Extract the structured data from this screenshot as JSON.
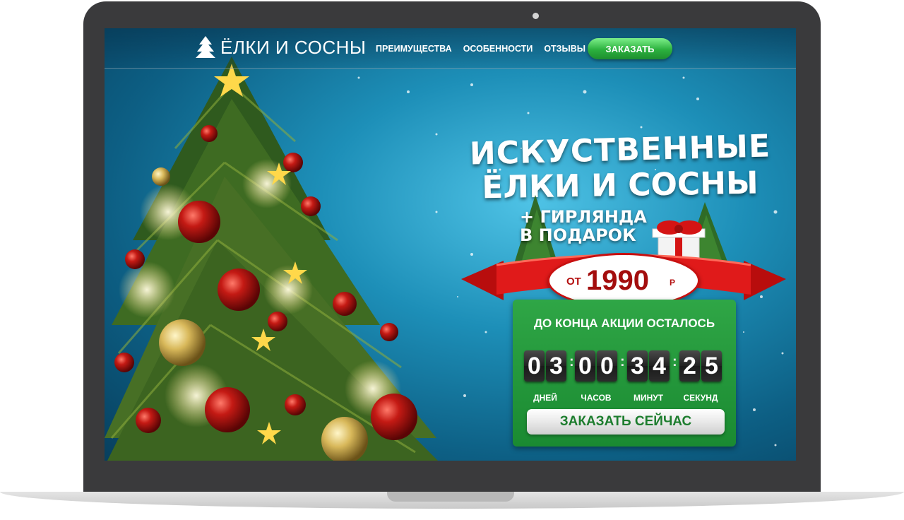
{
  "brand": {
    "name": "ЁЛКИ И СОСНЫ"
  },
  "nav": {
    "links": [
      "ПРЕИМУЩЕСТВА",
      "ОСОБЕННОСТИ",
      "ОТЗЫВЫ"
    ],
    "order_label": "ЗАКАЗАТЬ"
  },
  "hero": {
    "title_line1": "ИСКУСТВЕННЫЕ",
    "title_line2": "ЁЛКИ И СОСНЫ",
    "gift_line1": "+ ГИРЛЯНДА",
    "gift_line2": "В ПОДАРОК"
  },
  "price": {
    "prefix": "ОТ",
    "value": "1990",
    "currency": "Р"
  },
  "promo": {
    "title": "ДО КОНЦА АКЦИИ ОСТАЛОСЬ",
    "digits": [
      "0",
      "3",
      "0",
      "0",
      "3",
      "4",
      "2",
      "5"
    ],
    "units": [
      "ДНЕЙ",
      "ЧАСОВ",
      "МИНУТ",
      "СЕКУНД"
    ],
    "cta_label": "ЗАКАЗАТЬ СЕЙЧАС"
  },
  "colors": {
    "accent_green": "#2bb03e",
    "ribbon_red": "#c81010",
    "bg_blue": "#1d8fb8"
  }
}
